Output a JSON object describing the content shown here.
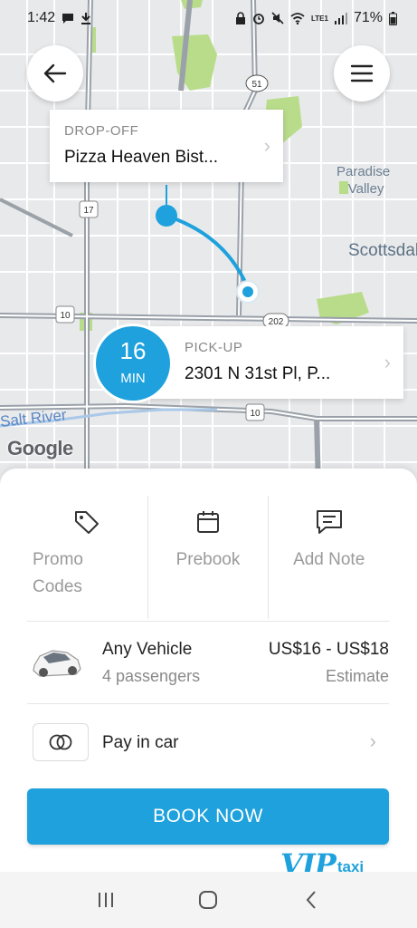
{
  "status_bar": {
    "time": "1:42",
    "network": "LTE1",
    "battery": "71%"
  },
  "map": {
    "place_labels": [
      "Paradise",
      "Valley",
      "Scottsdale",
      "Salt River"
    ],
    "highway_shields": [
      "17",
      "51",
      "10",
      "202",
      "10"
    ],
    "attribution": "Google"
  },
  "dropoff": {
    "label": "DROP-OFF",
    "address": "Pizza Heaven Bist..."
  },
  "pickup": {
    "label": "PICK-UP",
    "address": "2301 N 31st Pl, P..."
  },
  "eta": {
    "value": "16",
    "unit": "MIN"
  },
  "options": {
    "promo_line1": "Promo",
    "promo_line2": "Codes",
    "prebook": "Prebook",
    "add_note": "Add Note"
  },
  "vehicle": {
    "name": "Any Vehicle",
    "passengers": "4 passengers",
    "price": "US$16 - US$18",
    "estimate": "Estimate"
  },
  "payment": {
    "label": "Pay in car"
  },
  "book_button": "BOOK NOW",
  "brand": {
    "vip": "VIP",
    "taxi": "taxi"
  },
  "colors": {
    "accent": "#1ea1dc",
    "map_green": "#b8dc8a",
    "map_bg": "#e8e9eb"
  }
}
